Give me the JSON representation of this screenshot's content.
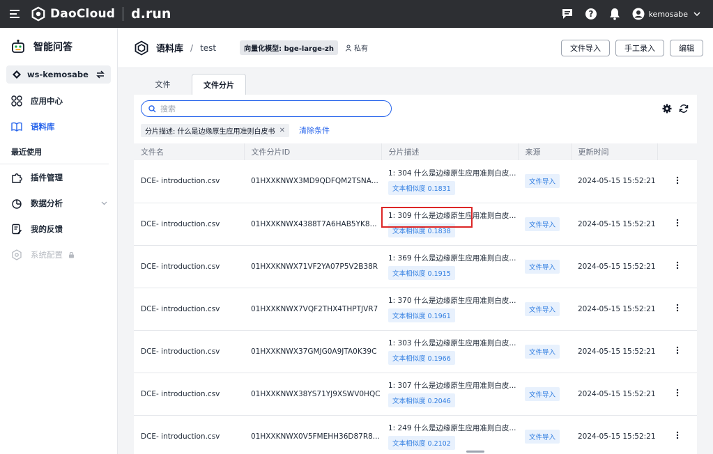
{
  "topbar": {
    "brand": "DaoCloud",
    "brand2": "d.run",
    "username": "kemosabe"
  },
  "sidebar": {
    "title": "智能问答",
    "workspace": "ws-kemosabe",
    "items": [
      {
        "label": "应用中心",
        "icon": "apps-icon"
      },
      {
        "label": "语料库",
        "icon": "book-icon",
        "active": true
      }
    ],
    "section_recent": "最近使用",
    "recent_items": [
      {
        "label": "插件管理",
        "icon": "puzzle-icon"
      },
      {
        "label": "数据分析",
        "icon": "pie-chart-icon",
        "has_caret": true
      },
      {
        "label": "我的反馈",
        "icon": "feedback-icon"
      },
      {
        "label": "系统配置",
        "icon": "settings-icon",
        "disabled": true,
        "locked": true
      }
    ]
  },
  "header": {
    "crumb_root": "语料库",
    "crumb_sep": "/",
    "crumb_current": "test",
    "model_tag": "向量化模型: bge-large-zh",
    "visibility": "私有",
    "buttons": {
      "import": "文件导入",
      "manual": "手工录入",
      "edit": "编辑"
    }
  },
  "tabs": [
    {
      "label": "文件",
      "active": false
    },
    {
      "label": "文件分片",
      "active": true
    }
  ],
  "search": {
    "placeholder": "搜索"
  },
  "filter": {
    "chip": "分片描述: 什么是边缘原生应用准则白皮书",
    "clear": "清除条件"
  },
  "table": {
    "columns": [
      "文件名",
      "文件分片ID",
      "分片描述",
      "来源",
      "更新时间",
      ""
    ],
    "rows": [
      {
        "file": "DCE- introduction.csv",
        "id": "01HXXKNWX3MD9QDFQM2TSNA...",
        "desc": "1: 304 什么是边缘原生应用准则白皮...",
        "sim": "文本相似度 0.1831",
        "source": "文件导入",
        "time": "2024-05-15 15:52:21"
      },
      {
        "file": "DCE- introduction.csv",
        "id": "01HXXKNWX4388T7A6HAB5YK8...",
        "desc": "1: 309 什么是边缘原生应用准则白皮...",
        "sim": "文本相似度 0.1838",
        "source": "文件导入",
        "time": "2024-05-15 15:52:21"
      },
      {
        "file": "DCE- introduction.csv",
        "id": "01HXXKNWX71VF2YA07P5V2B38R",
        "desc": "1: 369 什么是边缘原生应用准则白皮...",
        "sim": "文本相似度 0.1915",
        "source": "文件导入",
        "time": "2024-05-15 15:52:21"
      },
      {
        "file": "DCE- introduction.csv",
        "id": "01HXXKNWX7VQF2THX4THPTJVR7",
        "desc": "1: 370 什么是边缘原生应用准则白皮...",
        "sim": "文本相似度 0.1961",
        "source": "文件导入",
        "time": "2024-05-15 15:52:21"
      },
      {
        "file": "DCE- introduction.csv",
        "id": "01HXXKNWX37GMJG0A9JTA0K39C",
        "desc": "1: 303 什么是边缘原生应用准则白皮...",
        "sim": "文本相似度 0.1966",
        "source": "文件导入",
        "time": "2024-05-15 15:52:21"
      },
      {
        "file": "DCE- introduction.csv",
        "id": "01HXXKNWX38YS71YJ9XSWV0HQC",
        "desc": "1: 307 什么是边缘原生应用准则白皮...",
        "sim": "文本相似度 0.2046",
        "source": "文件导入",
        "time": "2024-05-15 15:52:21"
      },
      {
        "file": "DCE- introduction.csv",
        "id": "01HXXKNWX0V5FMEHH36D87R8...",
        "desc": "1: 249 什么是边缘原生应用准则白皮...",
        "sim": "文本相似度 0.2102",
        "source": "文件导入",
        "time": "2024-05-15 15:52:21"
      }
    ]
  },
  "colors": {
    "accent": "#2563eb",
    "topbar": "#2d2f33",
    "highlight": "#dc2626"
  }
}
